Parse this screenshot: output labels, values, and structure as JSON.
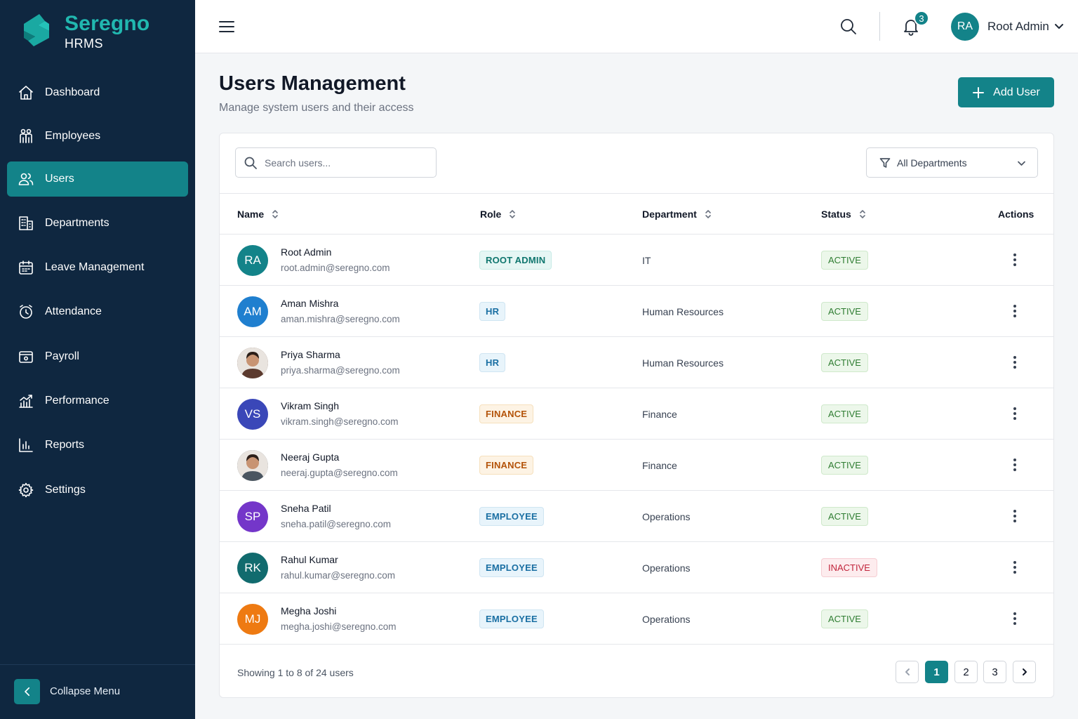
{
  "brand": {
    "name": "Seregno",
    "sub": "HRMS"
  },
  "sidebar": {
    "items": [
      {
        "label": "Dashboard",
        "icon": "home-icon"
      },
      {
        "label": "Employees",
        "icon": "employees-icon"
      },
      {
        "label": "Users",
        "icon": "users-icon",
        "active": true
      },
      {
        "label": "Departments",
        "icon": "building-icon"
      },
      {
        "label": "Leave Management",
        "icon": "calendar-icon"
      },
      {
        "label": "Attendance",
        "icon": "clock-icon"
      },
      {
        "label": "Payroll",
        "icon": "wallet-icon"
      },
      {
        "label": "Performance",
        "icon": "performance-chart-icon"
      },
      {
        "label": "Reports",
        "icon": "reports-icon"
      },
      {
        "label": "Settings",
        "icon": "gear-icon"
      }
    ],
    "collapse_label": "Collapse Menu"
  },
  "topbar": {
    "notifications_count": "3",
    "user_initials": "RA",
    "user_name": "Root Admin"
  },
  "page": {
    "title": "Users Management",
    "subtitle": "Manage system users and their access",
    "add_button": "Add User"
  },
  "filters": {
    "search_placeholder": "Search users...",
    "department_value": "All Departments"
  },
  "table": {
    "headers": {
      "name": "Name",
      "role": "Role",
      "department": "Department",
      "status": "Status",
      "actions": "Actions"
    },
    "rows": [
      {
        "initials": "RA",
        "avatar_color": "#138389",
        "name": "Root Admin",
        "email": "root.admin@seregno.com",
        "role": "ROOT ADMIN",
        "role_style": "teal",
        "department": "IT",
        "status": "ACTIVE"
      },
      {
        "initials": "AM",
        "avatar_color": "#1f7fcf",
        "name": "Aman Mishra",
        "email": "aman.mishra@seregno.com",
        "role": "HR",
        "role_style": "blue",
        "department": "Human Resources",
        "status": "ACTIVE"
      },
      {
        "initials": "",
        "avatar_color": "#5b3a2e",
        "photo": true,
        "name": "Priya Sharma",
        "email": "priya.sharma@seregno.com",
        "role": "HR",
        "role_style": "blue",
        "department": "Human Resources",
        "status": "ACTIVE"
      },
      {
        "initials": "VS",
        "avatar_color": "#3a47b8",
        "name": "Vikram Singh",
        "email": "vikram.singh@seregno.com",
        "role": "FINANCE",
        "role_style": "orange",
        "department": "Finance",
        "status": "ACTIVE"
      },
      {
        "initials": "",
        "avatar_color": "#4a5560",
        "photo": true,
        "name": "Neeraj Gupta",
        "email": "neeraj.gupta@seregno.com",
        "role": "FINANCE",
        "role_style": "orange",
        "department": "Finance",
        "status": "ACTIVE"
      },
      {
        "initials": "SP",
        "avatar_color": "#7436c9",
        "name": "Sneha Patil",
        "email": "sneha.patil@seregno.com",
        "role": "EMPLOYEE",
        "role_style": "blue",
        "department": "Operations",
        "status": "ACTIVE"
      },
      {
        "initials": "RK",
        "avatar_color": "#116b6e",
        "name": "Rahul Kumar",
        "email": "rahul.kumar@seregno.com",
        "role": "EMPLOYEE",
        "role_style": "blue",
        "department": "Operations",
        "status": "INACTIVE"
      },
      {
        "initials": "MJ",
        "avatar_color": "#ee7a12",
        "name": "Megha Joshi",
        "email": "megha.joshi@seregno.com",
        "role": "EMPLOYEE",
        "role_style": "blue",
        "department": "Operations",
        "status": "ACTIVE"
      }
    ]
  },
  "pagination": {
    "summary": "Showing 1 to 8 of 24 users",
    "pages": [
      "1",
      "2",
      "3"
    ],
    "current": "1"
  }
}
